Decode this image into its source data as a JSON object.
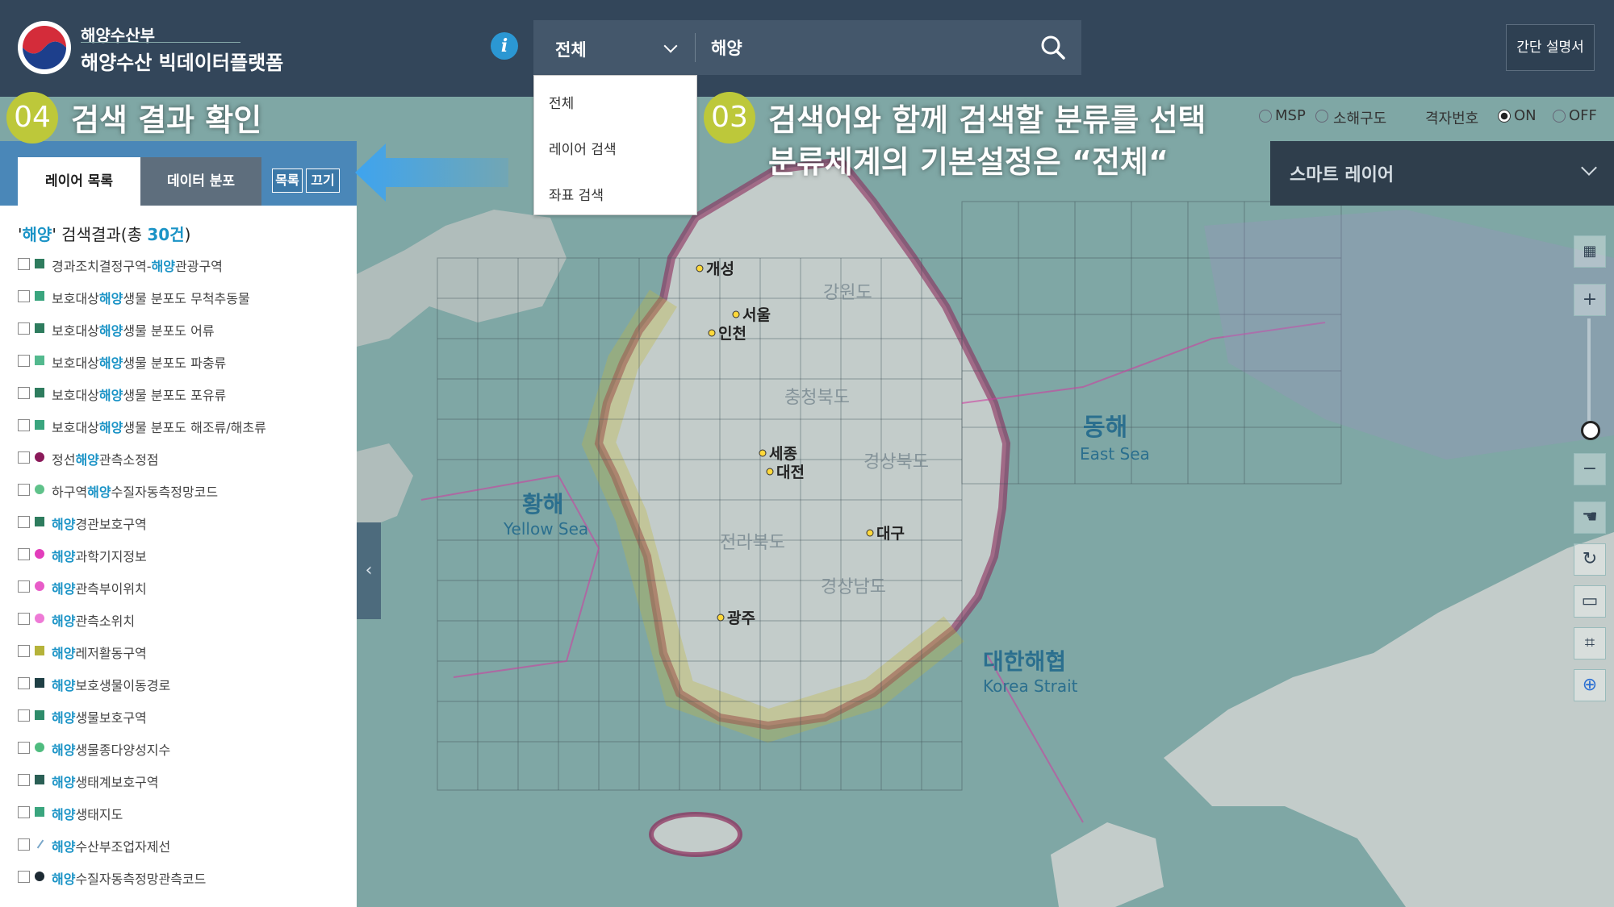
{
  "header": {
    "brand_top": "해양수산부",
    "brand_main": "해양수산 빅데이터플랫폼",
    "info_label": "i",
    "guide_button": "간단 설명서"
  },
  "search": {
    "category": "전체",
    "query": "해양"
  },
  "dropdown": {
    "options": [
      "전체",
      "레이어 검색",
      "좌표 검색"
    ]
  },
  "annotations": {
    "a04_num": "04",
    "a04_text": "검색 결과 확인",
    "a03_num": "03",
    "a03_line1": "검색어와 함께 검색할 분류를 선택",
    "a03_line2": "분류체계의 기본설정은 “전체“"
  },
  "panel": {
    "tab_layers": "레이어 목록",
    "tab_distribution": "데이터 분포",
    "btn_list": "목록",
    "btn_close": "끄기",
    "results_keyword": "해양",
    "results_prefix": "' 검색결과(총 ",
    "results_count": "30건",
    "results_suffix": ")",
    "layers": [
      {
        "pre": "경과조치결정구역-",
        "kw": "해양",
        "post": "관광구역",
        "color": "#2e7c5e",
        "shape": "square"
      },
      {
        "pre": "보호대상",
        "kw": "해양",
        "post": "생물 분포도 무척추동물",
        "color": "#3aa57e",
        "shape": "square"
      },
      {
        "pre": "보호대상",
        "kw": "해양",
        "post": "생물 분포도 어류",
        "color": "#2e7c5e",
        "shape": "square"
      },
      {
        "pre": "보호대상",
        "kw": "해양",
        "post": "생물 분포도 파충류",
        "color": "#53b98e",
        "shape": "square"
      },
      {
        "pre": "보호대상",
        "kw": "해양",
        "post": "생물 분포도 포유류",
        "color": "#2e7c5e",
        "shape": "square"
      },
      {
        "pre": "보호대상",
        "kw": "해양",
        "post": "생물 분포도 해조류/해초류",
        "color": "#3aa57e",
        "shape": "square"
      },
      {
        "pre": "정선",
        "kw": "해양",
        "post": "관측소정점",
        "color": "#8b1a5a",
        "shape": "circle"
      },
      {
        "pre": "하구역",
        "kw": "해양",
        "post": "수질자동측정망코드",
        "color": "#5fc28a",
        "shape": "circle"
      },
      {
        "pre": "",
        "kw": "해양",
        "post": "경관보호구역",
        "color": "#2e7c5e",
        "shape": "square"
      },
      {
        "pre": "",
        "kw": "해양",
        "post": "과학기지정보",
        "color": "#e23dbb",
        "shape": "circle"
      },
      {
        "pre": "",
        "kw": "해양",
        "post": "관측부이위치",
        "color": "#e85cc8",
        "shape": "circle"
      },
      {
        "pre": "",
        "kw": "해양",
        "post": "관측소위치",
        "color": "#ee7ad6",
        "shape": "circle"
      },
      {
        "pre": "",
        "kw": "해양",
        "post": "레저활동구역",
        "color": "#b5b33a",
        "shape": "square"
      },
      {
        "pre": "",
        "kw": "해양",
        "post": "보호생물이동경로",
        "color": "#1f3f45",
        "shape": "square"
      },
      {
        "pre": "",
        "kw": "해양",
        "post": "생물보호구역",
        "color": "#2e8c6a",
        "shape": "square"
      },
      {
        "pre": "",
        "kw": "해양",
        "post": "생물종다양성지수",
        "color": "#4fbc7f",
        "shape": "circle"
      },
      {
        "pre": "",
        "kw": "해양",
        "post": "생태계보호구역",
        "color": "#2a5f55",
        "shape": "square"
      },
      {
        "pre": "",
        "kw": "해양",
        "post": "생태지도",
        "color": "#3aa57e",
        "shape": "square"
      },
      {
        "pre": "",
        "kw": "해양",
        "post": "수산부조업자제선",
        "color": "#7aa7c9",
        "shape": "line"
      },
      {
        "pre": "",
        "kw": "해양",
        "post": "수질자동측정망관측코드",
        "color": "#1d2a33",
        "shape": "circle"
      }
    ]
  },
  "map_strip": {
    "opt_msp": "MSP",
    "opt_subgrid": "소해구도",
    "grid_label": "격자번호",
    "grid_on": "ON",
    "grid_off": "OFF"
  },
  "smart_layer": {
    "label": "스마트 레이어"
  },
  "map_labels": {
    "kaesong": "개성",
    "seoul": "서울",
    "incheon": "인천",
    "sejong": "세종",
    "daejeon": "대전",
    "daegu": "대구",
    "gwangju": "광주",
    "gangwon": "강원도",
    "chungbuk": "충청북도",
    "gyeongbuk": "경상북도",
    "jeonbuk": "전라북도",
    "gyeongnam": "경상남도",
    "east_sea_ko": "동해",
    "east_sea_en": "East Sea",
    "yellow_sea_ko": "황해",
    "yellow_sea_en": "Yellow Sea",
    "strait_ko": "대한해협",
    "strait_en": "Korea Strait"
  },
  "colors": {
    "header_bg": "#33465a",
    "panel_tab_bg": "#4a87b8",
    "accent_keyword": "#1a93c6",
    "annotation_badge": "#bdc83a",
    "map_sea": "#7fa7a5",
    "map_land": "#bfc8c6"
  }
}
